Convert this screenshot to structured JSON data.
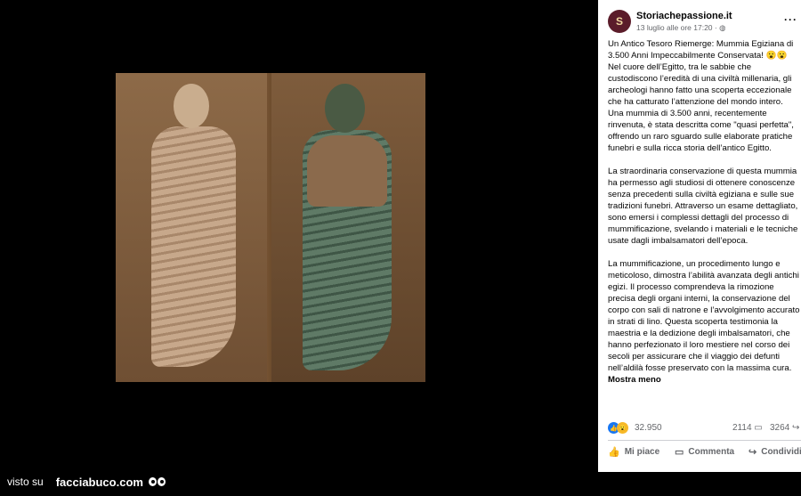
{
  "footer": {
    "prefix": "visto su",
    "brand": "facciabuco.com"
  },
  "post": {
    "page_name": "Storiachepassione.it",
    "date": "13 luglio alle ore 17:20 · ",
    "avatar_text": "S",
    "text": "Un Antico Tesoro Riemerge: Mummia Egiziana di 3.500 Anni Impeccabilmente Conservata! 😮😮\nNel cuore dell’Egitto, tra le sabbie che custodiscono l’eredità di una civiltà millenaria, gli archeologi hanno fatto una scoperta eccezionale che ha catturato l’attenzione del mondo intero. Una mummia di 3.500 anni, recentemente rinvenuta, è stata descritta come \"quasi perfetta\", offrendo un raro sguardo sulle elaborate pratiche funebri e sulla ricca storia dell’antico Egitto.\n\nLa straordinaria conservazione di questa mummia ha permesso agli studiosi di ottenere conoscenze senza precedenti sulla civiltà egiziana e sulle sue tradizioni funebri. Attraverso un esame dettagliato, sono emersi i complessi dettagli del processo di mummificazione, svelando i materiali e le tecniche usate dagli imbalsamatori dell’epoca.\n\nLa mummificazione, un procedimento lungo e meticoloso, dimostra l’abilità avanzata degli antichi egizi. Il processo comprendeva la rimozione precisa degli organi interni, la conservazione del corpo con sali di natrone e l’avvolgimento accurato in strati di lino. Questa scoperta testimonia la maestria e la dedizione degli imbalsamatori, che hanno perfezionato il loro mestiere nel corso dei secoli per assicurare che il viaggio dei defunti nell’aldilà fosse preservato con la massima cura. ",
    "see_more": "Mostra meno",
    "reactions_count": "32.950",
    "comments_count": "2114",
    "shares_count": "3264",
    "like_label": "Mi piace",
    "comment_label": "Commenta",
    "share_label": "Condividi"
  },
  "colors": {
    "like_blue": "#1877f2",
    "meta_gray": "#65676b"
  }
}
